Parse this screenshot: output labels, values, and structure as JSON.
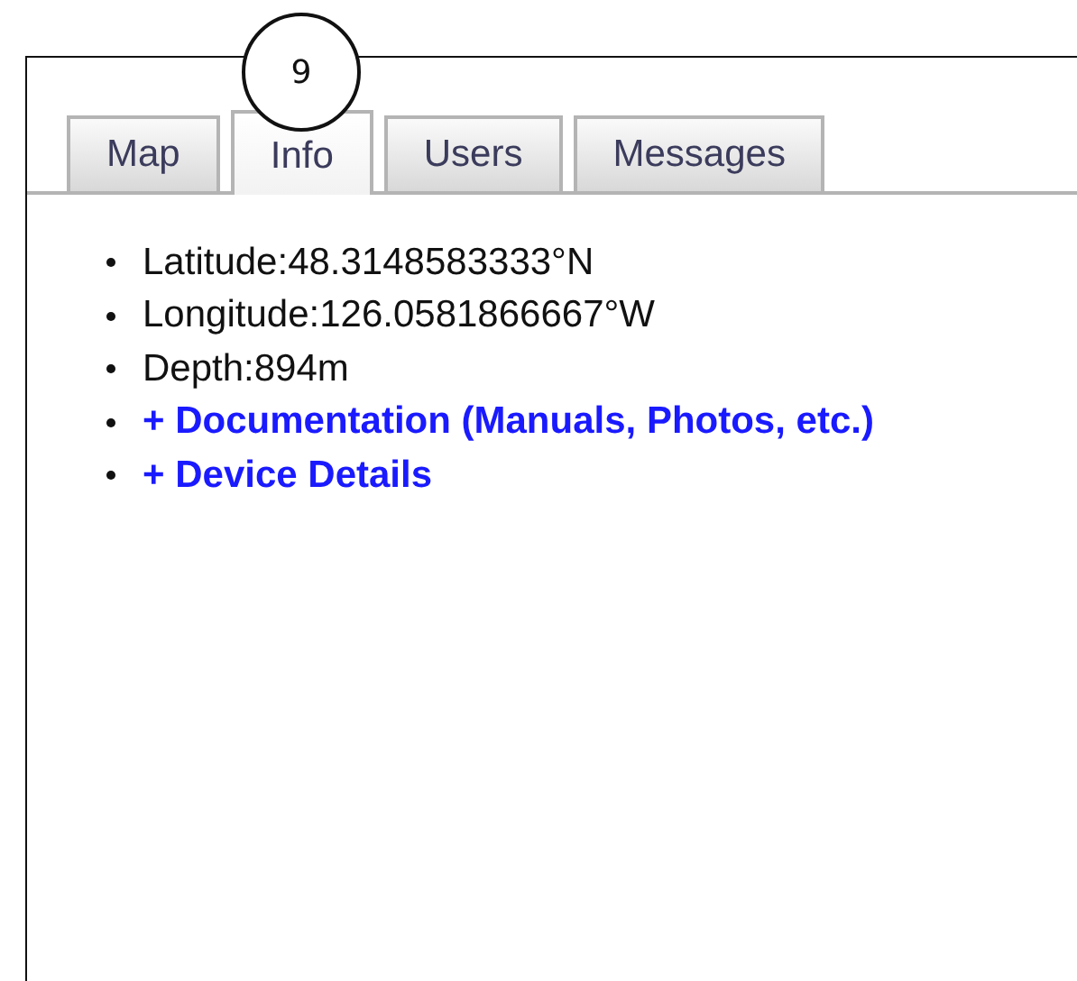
{
  "annotation": {
    "label": "9"
  },
  "tabs": [
    {
      "label": "Map",
      "selected": false
    },
    {
      "label": "Info",
      "selected": true
    },
    {
      "label": "Users",
      "selected": false
    },
    {
      "label": "Messages",
      "selected": false
    }
  ],
  "info_items": [
    {
      "kind": "text",
      "text": "Latitude:48.3148583333°N"
    },
    {
      "kind": "text",
      "text": "Longitude:126.0581866667°W"
    },
    {
      "kind": "text",
      "text": "Depth:894m"
    },
    {
      "kind": "link",
      "text": "+ Documentation (Manuals, Photos, etc.)"
    },
    {
      "kind": "link",
      "text": "+ Device Details"
    }
  ]
}
